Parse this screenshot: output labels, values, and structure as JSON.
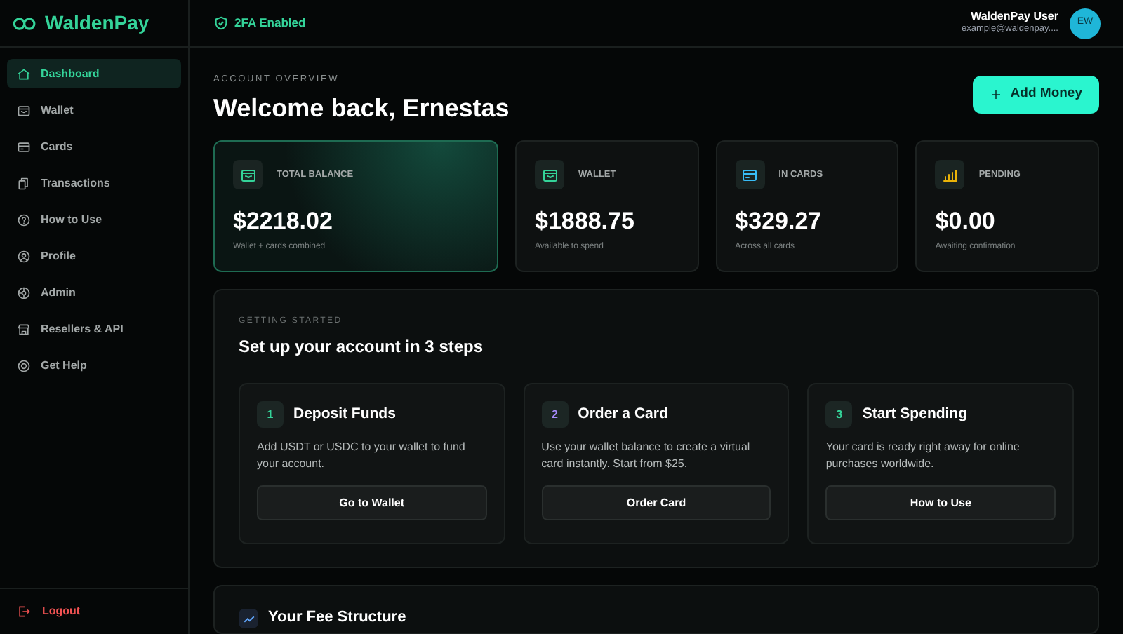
{
  "brand": "WaldenPay",
  "security_badge": "2FA Enabled",
  "user": {
    "name": "WaldenPay User",
    "email": "example@waldenpay....",
    "initials": "EW"
  },
  "sidebar": {
    "items": [
      {
        "label": "Dashboard",
        "kind": "home",
        "selected": true
      },
      {
        "label": "Wallet",
        "kind": "wallet",
        "selected": false
      },
      {
        "label": "Cards",
        "kind": "card",
        "selected": false
      },
      {
        "label": "Transactions",
        "kind": "docs",
        "selected": false
      },
      {
        "label": "How to Use",
        "kind": "help",
        "selected": false
      },
      {
        "label": "Profile",
        "kind": "user",
        "selected": false
      },
      {
        "label": "Admin",
        "kind": "admin",
        "selected": false
      },
      {
        "label": "Resellers & API",
        "kind": "store",
        "selected": false
      },
      {
        "label": "Get Help",
        "kind": "lifebuoy",
        "selected": false
      }
    ],
    "logout": "Logout"
  },
  "overview": {
    "eyebrow": "ACCOUNT OVERVIEW",
    "title": "Welcome back, Ernestas",
    "add_button": "Add Money"
  },
  "stats": [
    {
      "label": "TOTAL BALANCE",
      "value": "$2218.02",
      "note": "Wallet + cards combined",
      "kind": "wallet",
      "color": "#34d399",
      "selected": true
    },
    {
      "label": "WALLET",
      "value": "$1888.75",
      "note": "Available to spend",
      "kind": "wallet",
      "color": "#34d399",
      "selected": false
    },
    {
      "label": "IN CARDS",
      "value": "$329.27",
      "note": "Across all cards",
      "kind": "card",
      "color": "#38bdf8",
      "selected": false
    },
    {
      "label": "PENDING",
      "value": "$0.00",
      "note": "Awaiting confirmation",
      "kind": "bars",
      "color": "#eab308",
      "selected": false
    }
  ],
  "getting_started": {
    "eyebrow": "GETTING STARTED",
    "title": "Set up your account in 3 steps",
    "steps": [
      {
        "number": "1",
        "title": "Deposit Funds",
        "text": "Add USDT or USDC to your wallet to fund your account.",
        "button": "Go to Wallet",
        "color": "#34d399"
      },
      {
        "number": "2",
        "title": "Order a Card",
        "text": "Use your wallet balance to create a virtual card instantly. Start from $25.",
        "button": "Order Card",
        "color": "#a78bfa"
      },
      {
        "number": "3",
        "title": "Start Spending",
        "text": "Your card is ready right away for online purchases worldwide.",
        "button": "How to Use",
        "color": "#34d399"
      }
    ]
  },
  "fee_structure": {
    "title": "Your Fee Structure"
  }
}
